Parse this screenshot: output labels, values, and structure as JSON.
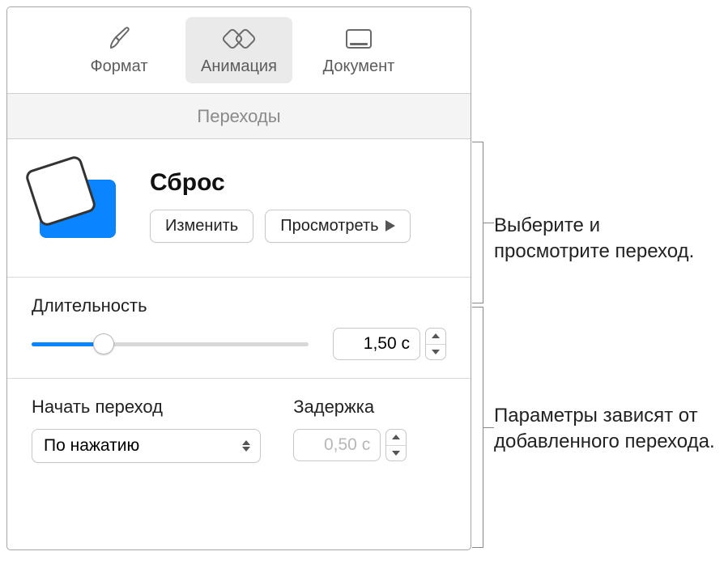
{
  "toolbar": {
    "format": "Формат",
    "animation": "Анимация",
    "document": "Документ"
  },
  "subheader": "Переходы",
  "transition": {
    "title": "Сброс",
    "change_btn": "Изменить",
    "preview_btn": "Просмотреть"
  },
  "duration": {
    "label": "Длительность",
    "value": "1,50 с"
  },
  "start": {
    "label": "Начать переход",
    "value": "По нажатию"
  },
  "delay": {
    "label": "Задержка",
    "value": "0,50 с"
  },
  "callouts": {
    "c1": "Выберите и просмотрите переход.",
    "c2": "Параметры зависят от добавленного перехода."
  }
}
